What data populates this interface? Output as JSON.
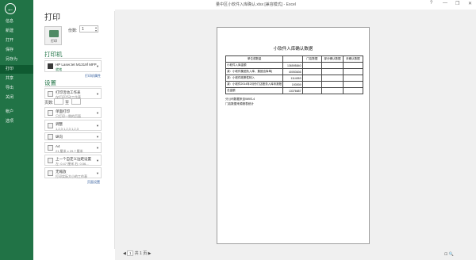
{
  "window": {
    "title": "量中区小软件入库确认.xlsx [兼容模式] - Excel",
    "help": "?",
    "minimize": "—",
    "restore": "❐",
    "close": "✕"
  },
  "backstage": {
    "back": "←",
    "items": [
      {
        "label": "信息",
        "active": false
      },
      {
        "label": "新建",
        "active": false
      },
      {
        "label": "打开",
        "active": false
      },
      {
        "label": "保存",
        "active": false
      },
      {
        "label": "另存为",
        "active": false
      },
      {
        "label": "打印",
        "active": true
      },
      {
        "label": "共享",
        "active": false
      },
      {
        "label": "导出",
        "active": false
      },
      {
        "label": "关闭",
        "active": false
      }
    ],
    "bottom_items": [
      {
        "label": "帐户"
      },
      {
        "label": "选项"
      }
    ]
  },
  "print_panel": {
    "heading": "打印",
    "print_button_label": "打印",
    "copies_label": "份数:",
    "copies_value": "1",
    "printer_section": "打印机",
    "printer_name": "HP LaserJet M1319f MFP",
    "printer_status": "就绪",
    "printer_properties_link": "打印机属性",
    "settings_section": "设置",
    "options": [
      {
        "main": "打印活动工作表",
        "sub": "仅打印活动工作表"
      },
      {
        "main": "单面打印",
        "sub": "只打印一侧的页面"
      },
      {
        "main": "调整",
        "sub": "1,2,3   1,2,3   1,2,3"
      },
      {
        "main": "纵向",
        "sub": ""
      },
      {
        "main": "A4",
        "sub": "21 厘米 x 29.7 厘米"
      },
      {
        "main": "上一个自定义边距设置",
        "sub": "左: 0.47 厘米   右: 0.56..."
      },
      {
        "main": "无缩放",
        "sub": "打印实际大小的工作表"
      }
    ],
    "pages_label": "页数:",
    "pages_to": "至",
    "page_setup_link": "页面设置"
  },
  "preview": {
    "doc_title": "小软件入库确认数据",
    "table": {
      "header": [
        "单位或数量",
        "",
        "门店数据",
        "部分确认数据",
        "未确认数据"
      ],
      "rows": [
        [
          "小软件入库金额",
          "136595840",
          "",
          "",
          ""
        ],
        [
          "减：小软件集团负入库、集团出库单(",
          "40053636",
          "",
          "",
          ""
        ],
        [
          "减：小软件政策性转入",
          "1114053",
          "",
          "",
          ""
        ],
        [
          "减：小软件2014年2月份门店账务入库未报账",
          "193939",
          "",
          "",
          ""
        ],
        [
          "总金额",
          "13376687",
          "",
          "",
          ""
        ]
      ]
    },
    "notes": [
      "分公司数据来自WMS-4",
      "门店数据来源报表统计"
    ],
    "pager": {
      "current": "1",
      "total_text": "共 1 页",
      "prev": "◀",
      "next": "▶"
    }
  },
  "status": {
    "zoom_fit": "⊡",
    "zoom": "🔍"
  }
}
